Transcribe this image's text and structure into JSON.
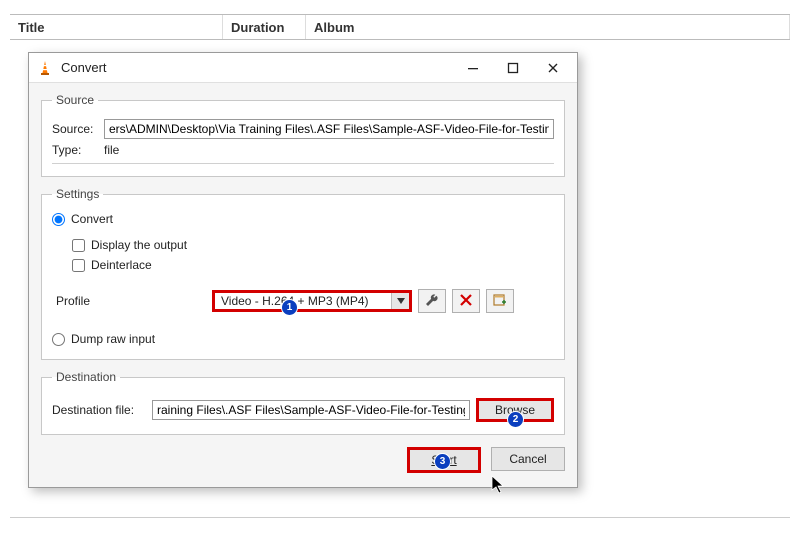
{
  "table_headers": {
    "title": "Title",
    "duration": "Duration",
    "album": "Album"
  },
  "dialog": {
    "title": "Convert",
    "source_group": {
      "legend": "Source",
      "source_label": "Source:",
      "source_value": "ers\\ADMIN\\Desktop\\Via Training Files\\.ASF Files\\Sample-ASF-Video-File-for-Testing.asf",
      "type_label": "Type:",
      "type_value": "file"
    },
    "settings_group": {
      "legend": "Settings",
      "convert_label": "Convert",
      "display_output_label": "Display the output",
      "deinterlace_label": "Deinterlace",
      "profile_label": "Profile",
      "profile_value": "Video - H.264 + MP3 (MP4)",
      "dump_raw_label": "Dump raw input"
    },
    "destination_group": {
      "legend": "Destination",
      "dest_label": "Destination file:",
      "dest_value": "raining Files\\.ASF Files\\Sample-ASF-Video-File-for-Testing.asf",
      "browse_label": "Browse"
    },
    "buttons": {
      "start": "Start",
      "cancel": "Cancel"
    }
  },
  "annotations": {
    "b1": "1",
    "b2": "2",
    "b3": "3"
  }
}
